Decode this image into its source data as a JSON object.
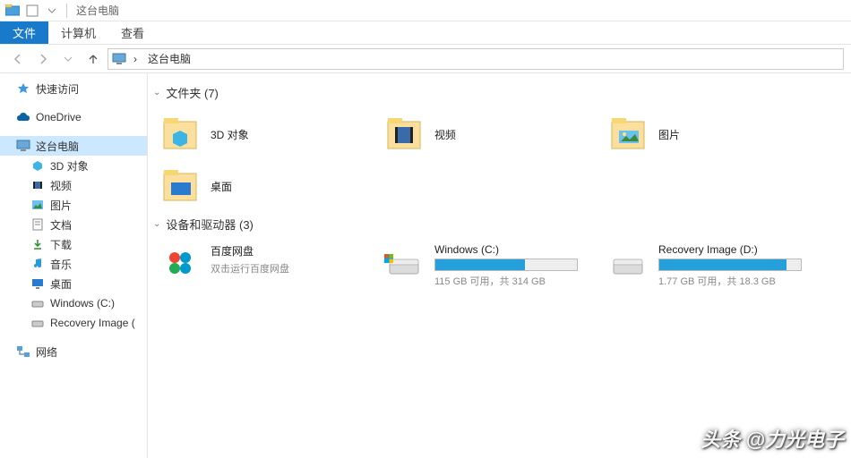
{
  "titlebar": {
    "title": "这台电脑"
  },
  "ribbon": {
    "file": "文件",
    "computer": "计算机",
    "view": "查看"
  },
  "breadcrumb": {
    "root_icon": "pc-icon",
    "sep": "›",
    "location": "这台电脑"
  },
  "sidebar": {
    "quick_access": "快速访问",
    "onedrive": "OneDrive",
    "this_pc": "这台电脑",
    "children": [
      {
        "label": "3D 对象",
        "icon": "3d"
      },
      {
        "label": "视频",
        "icon": "video"
      },
      {
        "label": "图片",
        "icon": "pic"
      },
      {
        "label": "文档",
        "icon": "doc"
      },
      {
        "label": "下载",
        "icon": "download"
      },
      {
        "label": "音乐",
        "icon": "music"
      },
      {
        "label": "桌面",
        "icon": "desktop"
      },
      {
        "label": "Windows (C:)",
        "icon": "drive"
      },
      {
        "label": "Recovery Image (",
        "icon": "drive"
      }
    ],
    "network": "网络"
  },
  "groups": {
    "folders_label": "文件夹 (7)",
    "devices_label": "设备和驱动器 (3)"
  },
  "folders": [
    {
      "label": "3D 对象",
      "icon": "3d"
    },
    {
      "label": "视频",
      "icon": "video"
    },
    {
      "label": "图片",
      "icon": "pic"
    },
    {
      "label": "桌面",
      "icon": "desktop"
    }
  ],
  "devices": [
    {
      "label": "百度网盘",
      "sub": "双击运行百度网盘",
      "icon": "baidu",
      "has_bar": false
    },
    {
      "label": "Windows (C:)",
      "sub": "115 GB 可用，共 314 GB",
      "icon": "drive-win",
      "has_bar": true,
      "fill_pct": 63
    },
    {
      "label": "Recovery Image (D:)",
      "sub": "1.77 GB 可用，共 18.3 GB",
      "icon": "drive",
      "has_bar": true,
      "fill_pct": 90
    }
  ],
  "watermark": "头条 @力光电子"
}
